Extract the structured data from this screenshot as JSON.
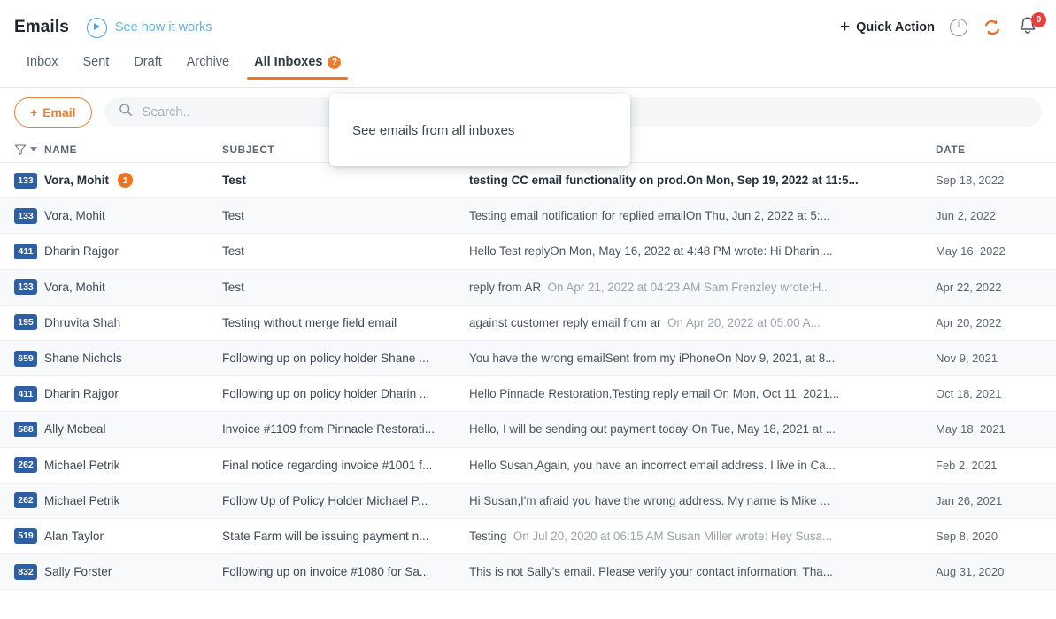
{
  "header": {
    "title": "Emails",
    "how_it_works": "See how it works",
    "play_icon": "play-circle-icon",
    "quick_action": "Quick Action",
    "plus": "+",
    "info_icon": "info-icon",
    "refresh_icon": "refresh-sync-icon",
    "bell_icon": "notification-bell-icon",
    "bell_badge": "9"
  },
  "tabs": [
    {
      "label": "Inbox",
      "active": false
    },
    {
      "label": "Sent",
      "active": false
    },
    {
      "label": "Draft",
      "active": false
    },
    {
      "label": "Archive",
      "active": false
    },
    {
      "label": "All Inboxes",
      "active": true,
      "help": "?"
    }
  ],
  "toolbar": {
    "email_button": "Email",
    "email_plus": "+",
    "search_placeholder": "Search..",
    "search_value": "",
    "search_icon": "search-icon"
  },
  "tooltip": {
    "text": "See emails from all inboxes"
  },
  "table": {
    "columns": {
      "name": "NAME",
      "subject": "SUBJECT",
      "date": "DATE"
    },
    "filter_icon": "filter-funnel-icon",
    "rows": [
      {
        "id": "133",
        "name": "Vora, Mohit",
        "count": "1",
        "unread": true,
        "subject": "Test",
        "preview": "testing CC email functionality on prod.On Mon, Sep 19, 2022 at 11:5...",
        "quoted": "",
        "date": "Sep 18, 2022"
      },
      {
        "id": "133",
        "name": "Vora, Mohit",
        "count": "",
        "unread": false,
        "subject": "Test",
        "preview": "Testing email notification for replied emailOn Thu, Jun 2, 2022 at 5:...",
        "quoted": "",
        "date": "Jun 2, 2022"
      },
      {
        "id": "411",
        "name": "Dharin Rajgor",
        "count": "",
        "unread": false,
        "subject": "Test",
        "preview": "Hello Test replyOn Mon, May 16, 2022 at 4:48 PM wrote: Hi Dharin,...",
        "quoted": "",
        "date": "May 16, 2022"
      },
      {
        "id": "133",
        "name": "Vora, Mohit",
        "count": "",
        "unread": false,
        "subject": "Test",
        "preview": "reply from AR",
        "quoted": "On Apr 21, 2022 at 04:23 AM Sam Frenzley wrote:H...",
        "date": "Apr 22, 2022"
      },
      {
        "id": "195",
        "name": "Dhruvita Shah",
        "count": "",
        "unread": false,
        "subject": "Testing without merge field email",
        "preview": "against customer reply email from ar",
        "quoted": "On Apr 20, 2022 at 05:00 A...",
        "date": "Apr 20, 2022"
      },
      {
        "id": "659",
        "name": "Shane Nichols",
        "count": "",
        "unread": false,
        "subject": "Following up on policy holder Shane ...",
        "preview": "You have the wrong emailSent from my iPhoneOn Nov 9, 2021, at 8...",
        "quoted": "",
        "date": "Nov 9, 2021"
      },
      {
        "id": "411",
        "name": "Dharin Rajgor",
        "count": "",
        "unread": false,
        "subject": "Following up on policy holder Dharin ...",
        "preview": "Hello Pinnacle Restoration,Testing reply email  On Mon, Oct 11, 2021...",
        "quoted": "",
        "date": "Oct 18, 2021"
      },
      {
        "id": "588",
        "name": "Ally Mcbeal",
        "count": "",
        "unread": false,
        "subject": "Invoice #1109 from Pinnacle Restorati...",
        "preview": "Hello, I will be sending out payment today·On Tue, May 18, 2021 at ...",
        "quoted": "",
        "date": "May 18, 2021"
      },
      {
        "id": "262",
        "name": "Michael Petrik",
        "count": "",
        "unread": false,
        "subject": "Final notice regarding invoice #1001 f...",
        "preview": "Hello Susan,Again, you have an incorrect email address.  I live in Ca...",
        "quoted": "",
        "date": "Feb 2, 2021"
      },
      {
        "id": "262",
        "name": "Michael Petrik",
        "count": "",
        "unread": false,
        "subject": "Follow Up of Policy Holder Michael P...",
        "preview": "Hi Susan,I'm afraid you have the wrong address.  My name is Mike ...",
        "quoted": "",
        "date": "Jan 26, 2021"
      },
      {
        "id": "519",
        "name": "Alan Taylor",
        "count": "",
        "unread": false,
        "subject": "State Farm will be issuing payment n...",
        "preview": "Testing",
        "quoted": "On Jul 20, 2020 at 06:15 AM Susan Miller wrote: Hey Susa...",
        "date": "Sep 8, 2020"
      },
      {
        "id": "832",
        "name": "Sally Forster",
        "count": "",
        "unread": false,
        "subject": "Following up on invoice #1080 for Sa...",
        "preview": "This is not Sally's email. Please verify your contact information. Tha...",
        "quoted": "",
        "date": "Aug 31, 2020"
      }
    ]
  },
  "colors": {
    "accent_orange": "#ed7d31",
    "badge_blue": "#2e5fa3",
    "link_blue": "#63b3e8",
    "alert_red": "#e8413c"
  }
}
